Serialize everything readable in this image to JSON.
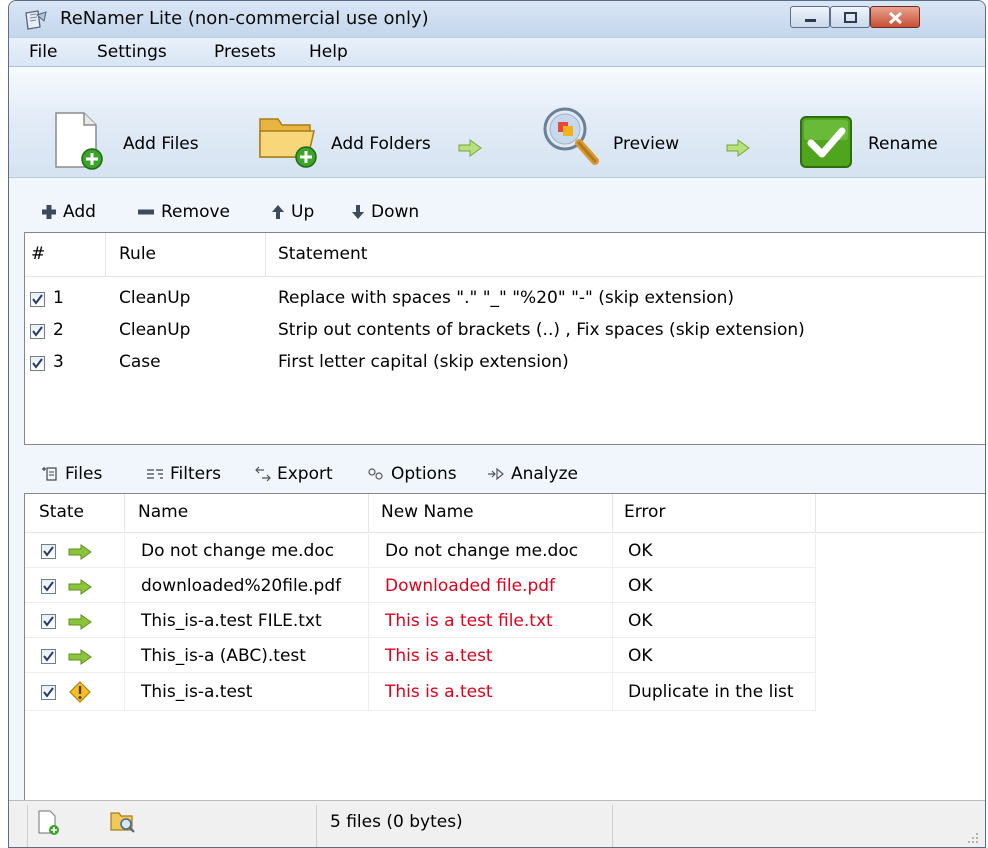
{
  "window": {
    "title": "ReNamer Lite (non-commercial use only)"
  },
  "icons": [
    "app-icon",
    "minimize-icon",
    "maximize-icon",
    "close-icon",
    "add-files-icon",
    "add-folders-icon",
    "arrow-right-icon",
    "preview-icon",
    "rename-icon",
    "plus-icon",
    "minus-icon",
    "up-arrow-icon",
    "down-arrow-icon",
    "files-icon",
    "filters-icon",
    "export-icon",
    "options-icon",
    "analyze-icon",
    "green-arrow-icon",
    "warning-icon",
    "checkbox-icon",
    "new-file-icon",
    "folder-search-icon"
  ],
  "colors": {
    "accent_red": "#e0001c",
    "title_bg": "#c9d9ee",
    "rename_green": "#4fa61e"
  },
  "menu": [
    "File",
    "Settings",
    "Presets",
    "Help"
  ],
  "toolbar": {
    "add_files": "Add Files",
    "add_folders": "Add Folders",
    "preview": "Preview",
    "rename": "Rename"
  },
  "rules_toolbar": {
    "add": "Add",
    "remove": "Remove",
    "up": "Up",
    "down": "Down"
  },
  "rules": {
    "headers": [
      "#",
      "Rule",
      "Statement"
    ],
    "rows": [
      {
        "checked": true,
        "num": "1",
        "rule": "CleanUp",
        "statement": "Replace with spaces \".\" \"_\" \"%20\" \"-\" (skip extension)"
      },
      {
        "checked": true,
        "num": "2",
        "rule": "CleanUp",
        "statement": "Strip out contents of brackets (..) , Fix spaces (skip extension)"
      },
      {
        "checked": true,
        "num": "3",
        "rule": "Case",
        "statement": "First letter capital (skip extension)"
      }
    ]
  },
  "files_toolbar": {
    "files": "Files",
    "filters": "Filters",
    "export": "Export",
    "options": "Options",
    "analyze": "Analyze"
  },
  "files": {
    "headers": [
      "State",
      "Name",
      "New Name",
      "Error"
    ],
    "rows": [
      {
        "checked": true,
        "state_icon": "green-arrow-icon",
        "name": "Do not change me.doc",
        "new_name": "Do not change me.doc",
        "changed": false,
        "error": "OK"
      },
      {
        "checked": true,
        "state_icon": "green-arrow-icon",
        "name": "downloaded%20file.pdf",
        "new_name": "Downloaded file.pdf",
        "changed": true,
        "error": "OK"
      },
      {
        "checked": true,
        "state_icon": "green-arrow-icon",
        "name": "This_is-a.test FILE.txt",
        "new_name": "This is a test file.txt",
        "changed": true,
        "error": "OK"
      },
      {
        "checked": true,
        "state_icon": "green-arrow-icon",
        "name": "This_is-a (ABC).test",
        "new_name": "This is a.test",
        "changed": true,
        "error": "OK"
      },
      {
        "checked": true,
        "state_icon": "warning-icon",
        "name": "This_is-a.test",
        "new_name": "This is a.test",
        "changed": true,
        "error": "Duplicate in the list"
      }
    ]
  },
  "status": {
    "summary": "5 files (0 bytes)"
  }
}
